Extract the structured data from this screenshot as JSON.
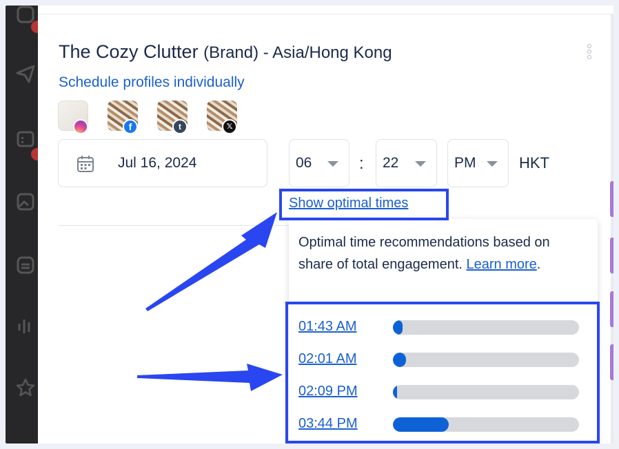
{
  "brand": {
    "name": "The Cozy Clutter",
    "suffix": "(Brand) - Asia/Hong Kong"
  },
  "schedule_link": "Schedule profiles individually",
  "profiles": [
    {
      "network": "instagram",
      "icon": "instagram-icon"
    },
    {
      "network": "facebook",
      "icon": "facebook-icon",
      "glyph": "f"
    },
    {
      "network": "tumblr",
      "icon": "tumblr-icon",
      "glyph": "t"
    },
    {
      "network": "x",
      "icon": "x-icon",
      "glyph": "𝕏"
    }
  ],
  "date": {
    "value": "Jul 16, 2024",
    "icon": "calendar-icon"
  },
  "time": {
    "hour": "06",
    "separator": ":",
    "minute": "22",
    "ampm": "PM",
    "timezone": "HKT"
  },
  "optimal": {
    "link": "Show optimal times",
    "description": "Optimal time recommendations based on share of total engagement.",
    "learn_more": "Learn more",
    "period": ".",
    "times": [
      {
        "label": "01:43 AM",
        "share": 0.05
      },
      {
        "label": "02:01 AM",
        "share": 0.07
      },
      {
        "label": "02:09 PM",
        "share": 0.02
      },
      {
        "label": "03:44 PM",
        "share": 0.3
      }
    ]
  },
  "colors": {
    "accent": "#1a5fd0",
    "bar_fill": "#0f62d6",
    "bar_track": "#d6d8dc",
    "highlight": "#2a46f0",
    "sidebar": "#27272a"
  }
}
